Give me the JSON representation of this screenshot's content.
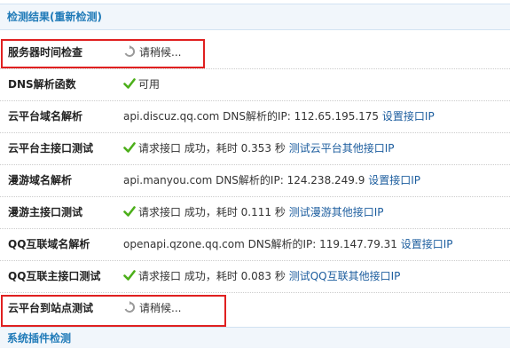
{
  "header": {
    "title": "检测结果(重新检测)"
  },
  "rows": [
    {
      "label": "服务器时间检查",
      "status": "请稍候..."
    },
    {
      "label": "DNS解析函数",
      "status": "可用"
    },
    {
      "label": "云平台域名解析",
      "domain": "api.discuz.qq.com",
      "dns_text": "DNS解析的IP:",
      "ip": "112.65.195.175",
      "link": "设置接口IP"
    },
    {
      "label": "云平台主接口测试",
      "request": "请求接口 成功，耗时",
      "time": "0.353",
      "unit": "秒",
      "link": "测试云平台其他接口IP"
    },
    {
      "label": "漫游域名解析",
      "domain": "api.manyou.com",
      "dns_text": "DNS解析的IP:",
      "ip": "124.238.249.9",
      "link": "设置接口IP"
    },
    {
      "label": "漫游主接口测试",
      "request": "请求接口 成功，耗时",
      "time": "0.111",
      "unit": "秒",
      "link": "测试漫游其他接口IP"
    },
    {
      "label": "QQ互联域名解析",
      "domain": "openapi.qzone.qq.com",
      "dns_text": "DNS解析的IP:",
      "ip": "119.147.79.31",
      "link": "设置接口IP"
    },
    {
      "label": "QQ互联主接口测试",
      "request": "请求接口 成功，耗时",
      "time": "0.083",
      "unit": "秒",
      "link": "测试QQ互联其他接口IP"
    },
    {
      "label": "云平台到站点测试",
      "status": "请稍候..."
    }
  ],
  "footer": {
    "title": "系统插件检测"
  },
  "colors": {
    "accent": "#1f7ab8",
    "link": "#1c5d9e",
    "highlight": "#e02020",
    "success": "#4caf1a"
  }
}
